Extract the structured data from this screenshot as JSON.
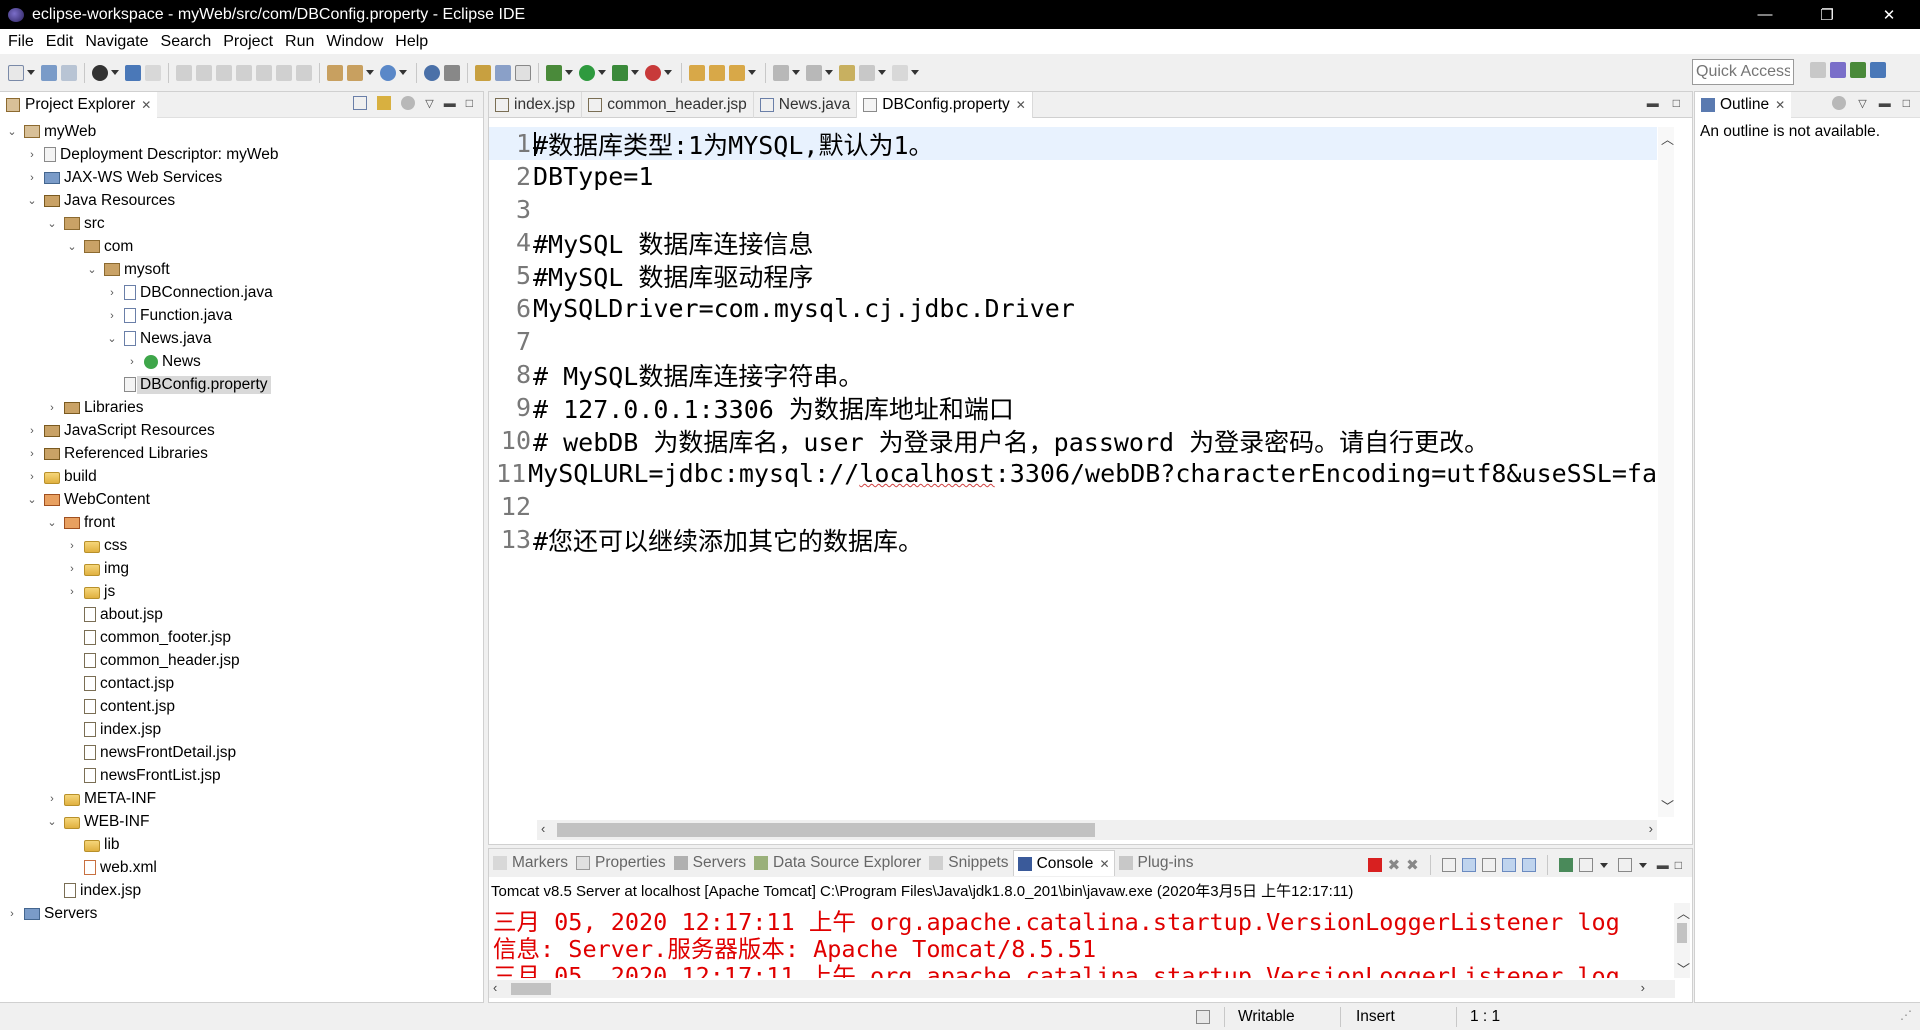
{
  "window": {
    "title": "eclipse-workspace - myWeb/src/com/DBConfig.property - Eclipse IDE",
    "minimize": "—",
    "maximize": "❐",
    "close": "✕"
  },
  "menu": [
    "File",
    "Edit",
    "Navigate",
    "Search",
    "Project",
    "Run",
    "Window",
    "Help"
  ],
  "toolbar": {
    "quick_access": "Quick Access"
  },
  "project_explorer": {
    "title": "Project Explorer",
    "tree": [
      {
        "label": "myWeb",
        "icon": "project-icon",
        "expanded": true
      },
      {
        "label": "Deployment Descriptor: myWeb",
        "icon": "descriptor-icon",
        "expanded": false
      },
      {
        "label": "JAX-WS Web Services",
        "icon": "webservices-icon",
        "expanded": false
      },
      {
        "label": "Java Resources",
        "icon": "java-resources-icon",
        "expanded": true
      },
      {
        "label": "src",
        "icon": "source-folder-icon",
        "expanded": true
      },
      {
        "label": "com",
        "icon": "package-icon",
        "expanded": true
      },
      {
        "label": "mysoft",
        "icon": "package-icon",
        "expanded": true
      },
      {
        "label": "DBConnection.java",
        "icon": "java-file-icon",
        "expanded": false
      },
      {
        "label": "Function.java",
        "icon": "java-file-icon",
        "expanded": false
      },
      {
        "label": "News.java",
        "icon": "java-file-icon",
        "expanded": true
      },
      {
        "label": "News",
        "icon": "class-icon",
        "expanded": false
      },
      {
        "label": "DBConfig.property",
        "icon": "property-file-icon",
        "expanded": null,
        "selected": true
      },
      {
        "label": "Libraries",
        "icon": "library-icon",
        "expanded": false
      },
      {
        "label": "JavaScript Resources",
        "icon": "js-resources-icon",
        "expanded": false
      },
      {
        "label": "Referenced Libraries",
        "icon": "library-icon",
        "expanded": false
      },
      {
        "label": "build",
        "icon": "folder-icon",
        "expanded": false
      },
      {
        "label": "WebContent",
        "icon": "web-folder-icon",
        "expanded": true
      },
      {
        "label": "front",
        "icon": "web-folder-icon",
        "expanded": true
      },
      {
        "label": "css",
        "icon": "folder-icon",
        "expanded": false
      },
      {
        "label": "img",
        "icon": "folder-icon",
        "expanded": false
      },
      {
        "label": "js",
        "icon": "folder-icon",
        "expanded": false
      },
      {
        "label": "about.jsp",
        "icon": "jsp-file-icon",
        "expanded": null
      },
      {
        "label": "common_footer.jsp",
        "icon": "jsp-file-icon",
        "expanded": null
      },
      {
        "label": "common_header.jsp",
        "icon": "jsp-file-icon",
        "expanded": null
      },
      {
        "label": "contact.jsp",
        "icon": "jsp-file-icon",
        "expanded": null
      },
      {
        "label": "content.jsp",
        "icon": "jsp-file-icon",
        "expanded": null
      },
      {
        "label": "index.jsp",
        "icon": "jsp-file-icon",
        "expanded": null
      },
      {
        "label": "newsFrontDetail.jsp",
        "icon": "jsp-file-icon",
        "expanded": null
      },
      {
        "label": "newsFrontList.jsp",
        "icon": "jsp-file-icon",
        "expanded": null
      },
      {
        "label": "META-INF",
        "icon": "folder-icon",
        "expanded": false
      },
      {
        "label": "WEB-INF",
        "icon": "folder-icon",
        "expanded": true
      },
      {
        "label": "lib",
        "icon": "folder-icon",
        "expanded": null
      },
      {
        "label": "web.xml",
        "icon": "xml-file-icon",
        "expanded": null
      },
      {
        "label": "index.jsp",
        "icon": "jsp-file-icon",
        "expanded": null
      },
      {
        "label": "Servers",
        "icon": "servers-folder-icon",
        "expanded": false
      }
    ]
  },
  "editor": {
    "tabs": [
      {
        "label": "index.jsp",
        "active": false
      },
      {
        "label": "common_header.jsp",
        "active": false
      },
      {
        "label": "News.java",
        "active": false
      },
      {
        "label": "DBConfig.property",
        "active": true
      }
    ],
    "lines": [
      {
        "num": "1",
        "text": "#数据库类型:1为MYSQL,默认为1。"
      },
      {
        "num": "2",
        "text": "DBType=1"
      },
      {
        "num": "3",
        "text": ""
      },
      {
        "num": "4",
        "text": "#MySQL 数据库连接信息"
      },
      {
        "num": "5",
        "text": "#MySQL 数据库驱动程序"
      },
      {
        "num": "6",
        "text": "MySQLDriver=com.mysql.cj.jdbc.Driver"
      },
      {
        "num": "7",
        "text": ""
      },
      {
        "num": "8",
        "text": "# MySQL数据库连接字符串。"
      },
      {
        "num": "9",
        "text": "# 127.0.0.1:3306 为数据库地址和端口"
      },
      {
        "num": "10",
        "text": "# webDB 为数据库名，user 为登录用户名，password 为登录密码。请自行更改。"
      },
      {
        "num": "11",
        "text": "MySQLURL=jdbc:mysql://localhost:3306/webDB?characterEncoding=utf8&useSSL=fa"
      },
      {
        "num": "12",
        "text": ""
      },
      {
        "num": "13",
        "text": "#您还可以继续添加其它的数据库。"
      }
    ]
  },
  "outline": {
    "title": "Outline",
    "message": "An outline is not available."
  },
  "bottom_panel": {
    "tabs": [
      {
        "label": "Markers",
        "active": false
      },
      {
        "label": "Properties",
        "active": false
      },
      {
        "label": "Servers",
        "active": false
      },
      {
        "label": "Data Source Explorer",
        "active": false
      },
      {
        "label": "Snippets",
        "active": false
      },
      {
        "label": "Console",
        "active": true
      },
      {
        "label": "Plug-ins",
        "active": false
      }
    ],
    "console_description": "Tomcat v8.5 Server at localhost [Apache Tomcat] C:\\Program Files\\Java\\jdk1.8.0_201\\bin\\javaw.exe (2020年3月5日 上午12:17:11)",
    "console_lines": [
      "三月 05, 2020 12:17:11 上午 org.apache.catalina.startup.VersionLoggerListener log",
      "信息: Server.服务器版本:   Apache Tomcat/8.5.51",
      "三月 05, 2020 12:17:11 上午 org.apache.catalina.startup.VersionLoggerListener log"
    ]
  },
  "statusbar": {
    "writable": "Writable",
    "insert_mode": "Insert",
    "position": "1 : 1"
  },
  "colors": {
    "console_text": "#E00000",
    "current_line": "#E8F2FE",
    "selection": "#D9D9D9"
  }
}
